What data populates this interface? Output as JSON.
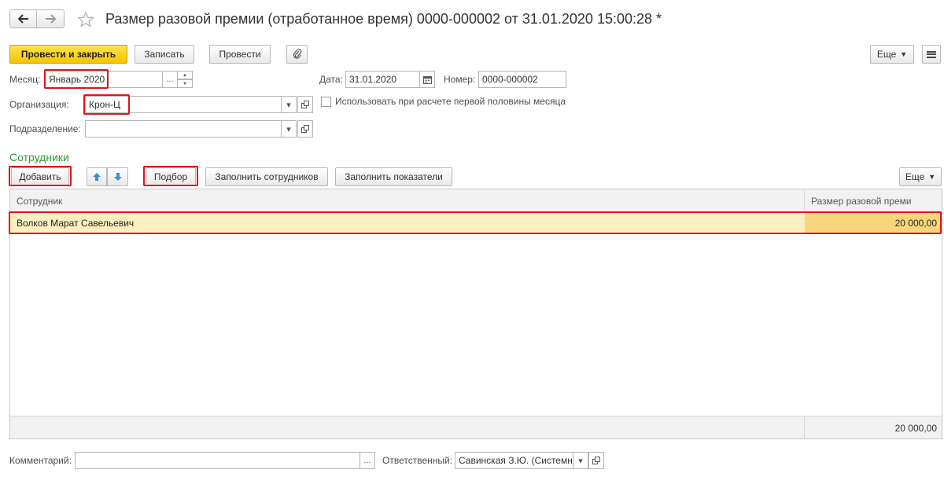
{
  "window": {
    "title": "Размер разовой премии (отработанное время) 0000-000002 от 31.01.2020 15:00:28 *"
  },
  "toolbar": {
    "post_close": "Провести и закрыть",
    "save": "Записать",
    "post": "Провести",
    "more": "Еще"
  },
  "form": {
    "month_label": "Месяц:",
    "month_value": "Январь 2020",
    "date_label": "Дата:",
    "date_value": "31.01.2020",
    "number_label": "Номер:",
    "number_value": "0000-000002",
    "org_label": "Организация:",
    "org_value": "Крон-Ц",
    "first_half_label": "Использовать при расчете первой половины месяца",
    "division_label": "Подразделение:",
    "division_value": ""
  },
  "employees": {
    "section_title": "Сотрудники",
    "add": "Добавить",
    "select": "Подбор",
    "fill_employees": "Заполнить сотрудников",
    "fill_indicators": "Заполнить показатели",
    "more": "Еще",
    "columns": [
      "Сотрудник",
      "Размер разовой преми"
    ],
    "rows": [
      {
        "employee": "Волков Марат Савельевич",
        "amount": "20 000,00"
      }
    ],
    "total": "20 000,00"
  },
  "footer": {
    "comment_label": "Комментарий:",
    "comment_value": "",
    "responsible_label": "Ответственный:",
    "responsible_value": "Савинская З.Ю. (Системн"
  },
  "icons": {
    "ellipsis": "...",
    "spin_up": "▲",
    "spin_down": "▼",
    "dropdown": "▾",
    "arrow_up": "↑",
    "arrow_down": "↓"
  },
  "colors": {
    "primary_button": "#f5c400",
    "section_title": "#2d9c3c",
    "selected_row": "#fcefc0",
    "selected_cell": "#f8d77c",
    "highlight_border": "#e0141e"
  }
}
